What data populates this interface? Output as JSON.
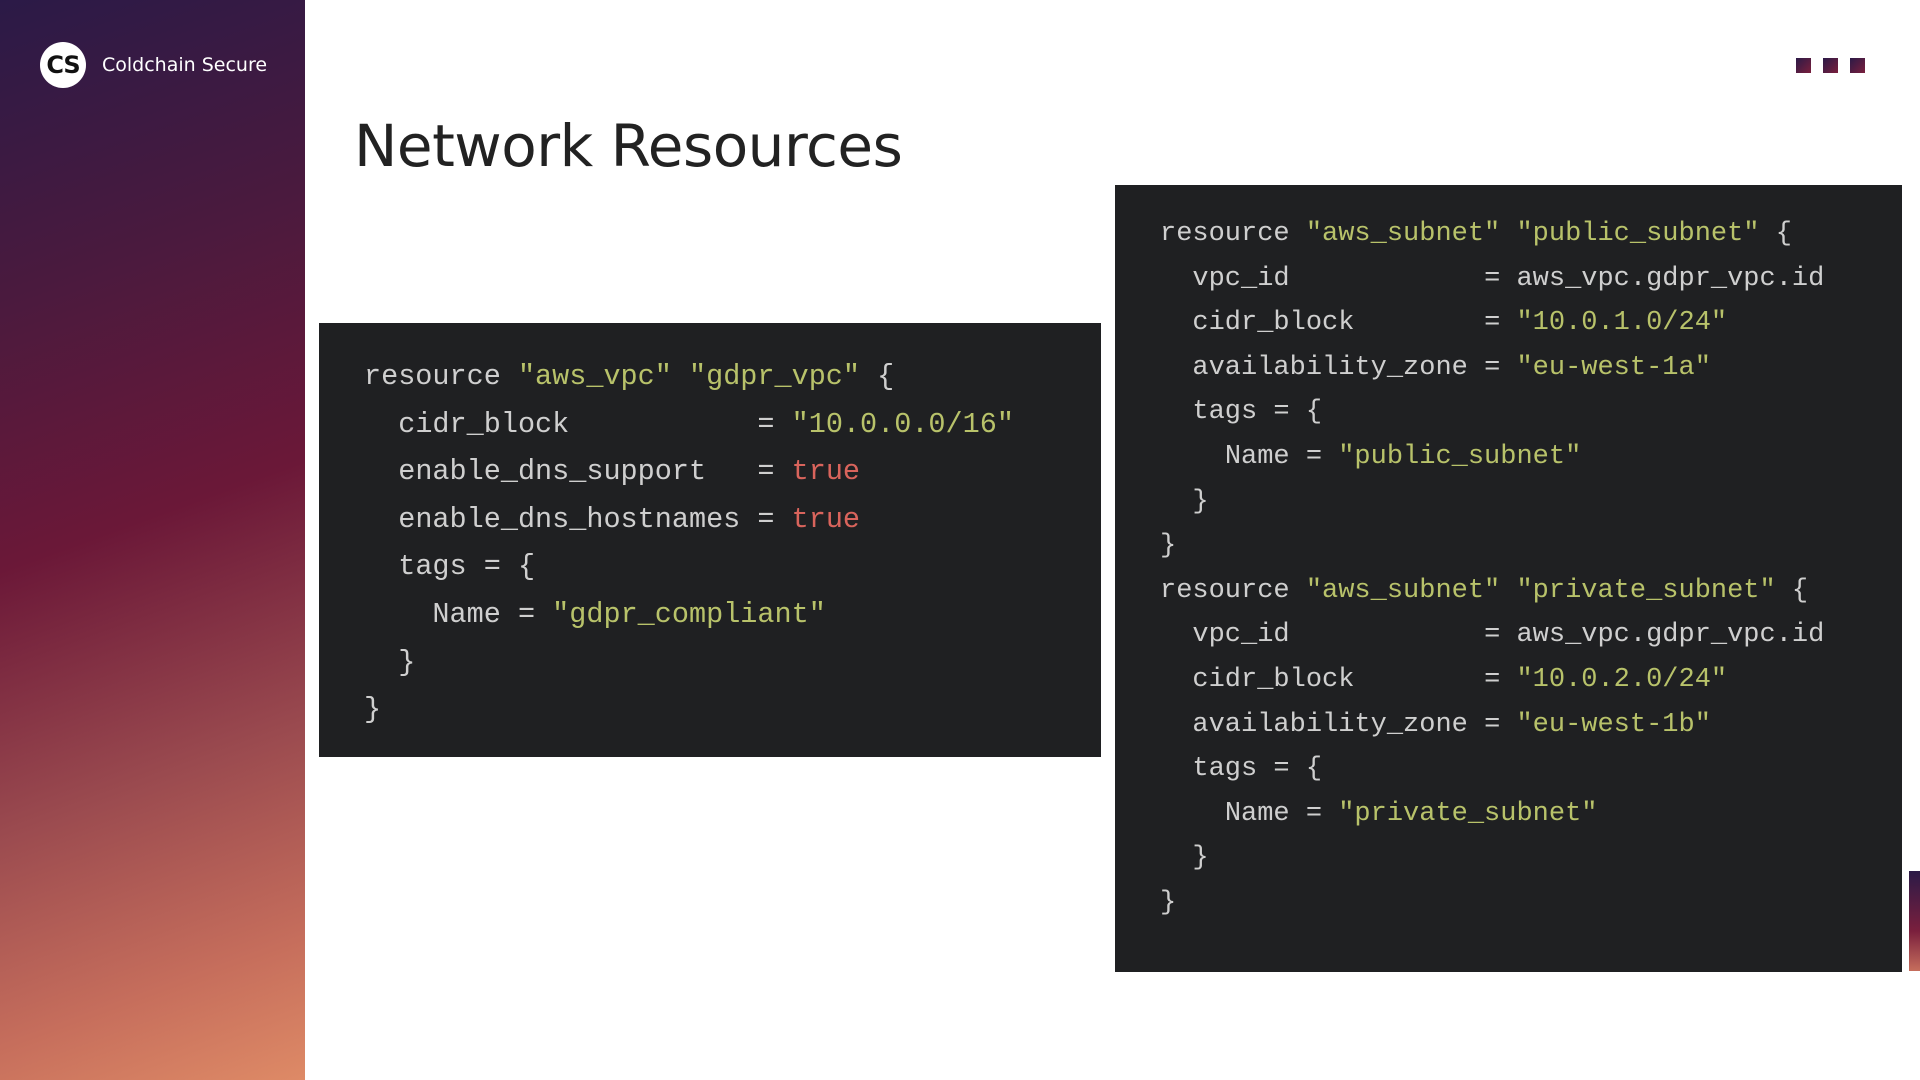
{
  "brand": {
    "logo_text": "CS",
    "name": "Coldchain Secure"
  },
  "page": {
    "title": "Network Resources"
  },
  "colors": {
    "sidebar_gradient": [
      "#2b1a47",
      "#6b1838",
      "#de8a66"
    ],
    "code_background": "#1f2022",
    "code_text": "#cfcfcf",
    "code_string": "#b8c26a",
    "code_boolean": "#d9645c"
  },
  "vpc_block": {
    "l1_kw": "resource",
    "l1_type": "\"aws_vpc\"",
    "l1_name": "\"gdpr_vpc\"",
    "l1_brace": "{",
    "l2_key": "cidr_block",
    "l2_eq": "=",
    "l2_val": "\"10.0.0.0/16\"",
    "l3_key": "enable_dns_support",
    "l3_eq": "=",
    "l3_val": "true",
    "l4_key": "enable_dns_hostnames",
    "l4_eq": "=",
    "l4_val": "true",
    "l5_key": "tags",
    "l5_eq": "=",
    "l5_brace": "{",
    "l6_key": "Name",
    "l6_eq": "=",
    "l6_val": "\"gdpr_compliant\"",
    "l7_brace": "}",
    "l8_brace": "}"
  },
  "subnet_block": {
    "a1_kw": "resource",
    "a1_type": "\"aws_subnet\"",
    "a1_name": "\"public_subnet\"",
    "a1_brace": "{",
    "a2_key": "vpc_id",
    "a2_eq": "=",
    "a2_val": "aws_vpc.gdpr_vpc.id",
    "a3_key": "cidr_block",
    "a3_eq": "=",
    "a3_val": "\"10.0.1.0/24\"",
    "a4_key": "availability_zone",
    "a4_eq": "=",
    "a4_val": "\"eu-west-1a\"",
    "a5_key": "tags",
    "a5_eq": "=",
    "a5_brace": "{",
    "a6_key": "Name",
    "a6_eq": "=",
    "a6_val": "\"public_subnet\"",
    "a7_brace": "}",
    "a8_brace": "}",
    "b1_kw": "resource",
    "b1_type": "\"aws_subnet\"",
    "b1_name": "\"private_subnet\"",
    "b1_brace": "{",
    "b2_key": "vpc_id",
    "b2_eq": "=",
    "b2_val": "aws_vpc.gdpr_vpc.id",
    "b3_key": "cidr_block",
    "b3_eq": "=",
    "b3_val": "\"10.0.2.0/24\"",
    "b4_key": "availability_zone",
    "b4_eq": "=",
    "b4_val": "\"eu-west-1b\"",
    "b5_key": "tags",
    "b5_eq": "=",
    "b5_brace": "{",
    "b6_key": "Name",
    "b6_eq": "=",
    "b6_val": "\"private_subnet\"",
    "b7_brace": "}",
    "b8_brace": "}"
  }
}
